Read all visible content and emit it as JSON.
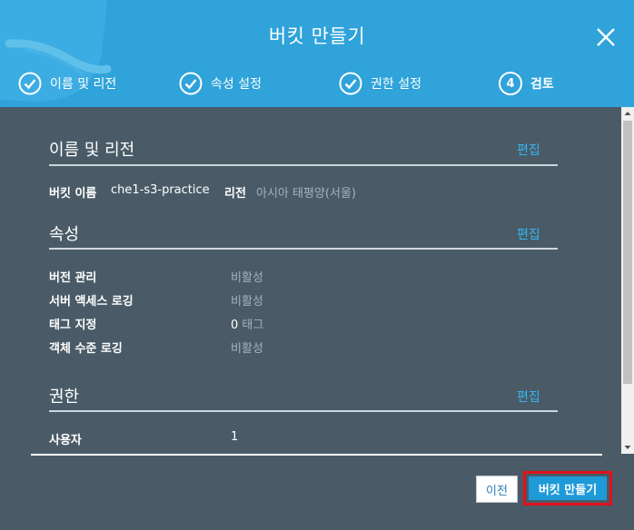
{
  "dialog": {
    "title": "버킷 만들기"
  },
  "steps": [
    {
      "label": "이름 및 리전",
      "status": "complete"
    },
    {
      "label": "속성 설정",
      "status": "complete"
    },
    {
      "label": "권한 설정",
      "status": "complete"
    },
    {
      "number": "4",
      "label": "검토",
      "status": "current"
    }
  ],
  "review": {
    "name_region": {
      "title": "이름 및 리전",
      "edit": "편집",
      "bucket_name_label": "버킷 이름",
      "bucket_name_value": "che1-s3-practice",
      "region_label": "리전",
      "region_value": "아시아 태평양(서울)"
    },
    "properties": {
      "title": "속성",
      "edit": "편집",
      "rows": [
        {
          "label": "버전 관리",
          "value": "비활성"
        },
        {
          "label": "서버 액세스 로깅",
          "value": "비활성"
        },
        {
          "label": "태그 지정",
          "count": "0",
          "unit": "태그"
        },
        {
          "label": "객체 수준 로깅",
          "value": "비활성"
        }
      ]
    },
    "permissions": {
      "title": "권한",
      "edit": "편집",
      "rows": [
        {
          "label": "사용자",
          "value": "1"
        }
      ]
    }
  },
  "footer": {
    "prev": "이전",
    "create": "버킷 만들기"
  },
  "colors": {
    "header": "#2fa3da",
    "content": "#4a5b67",
    "link": "#34b5ee",
    "primary": "#1e9ad8",
    "highlight": "#e2101b"
  }
}
